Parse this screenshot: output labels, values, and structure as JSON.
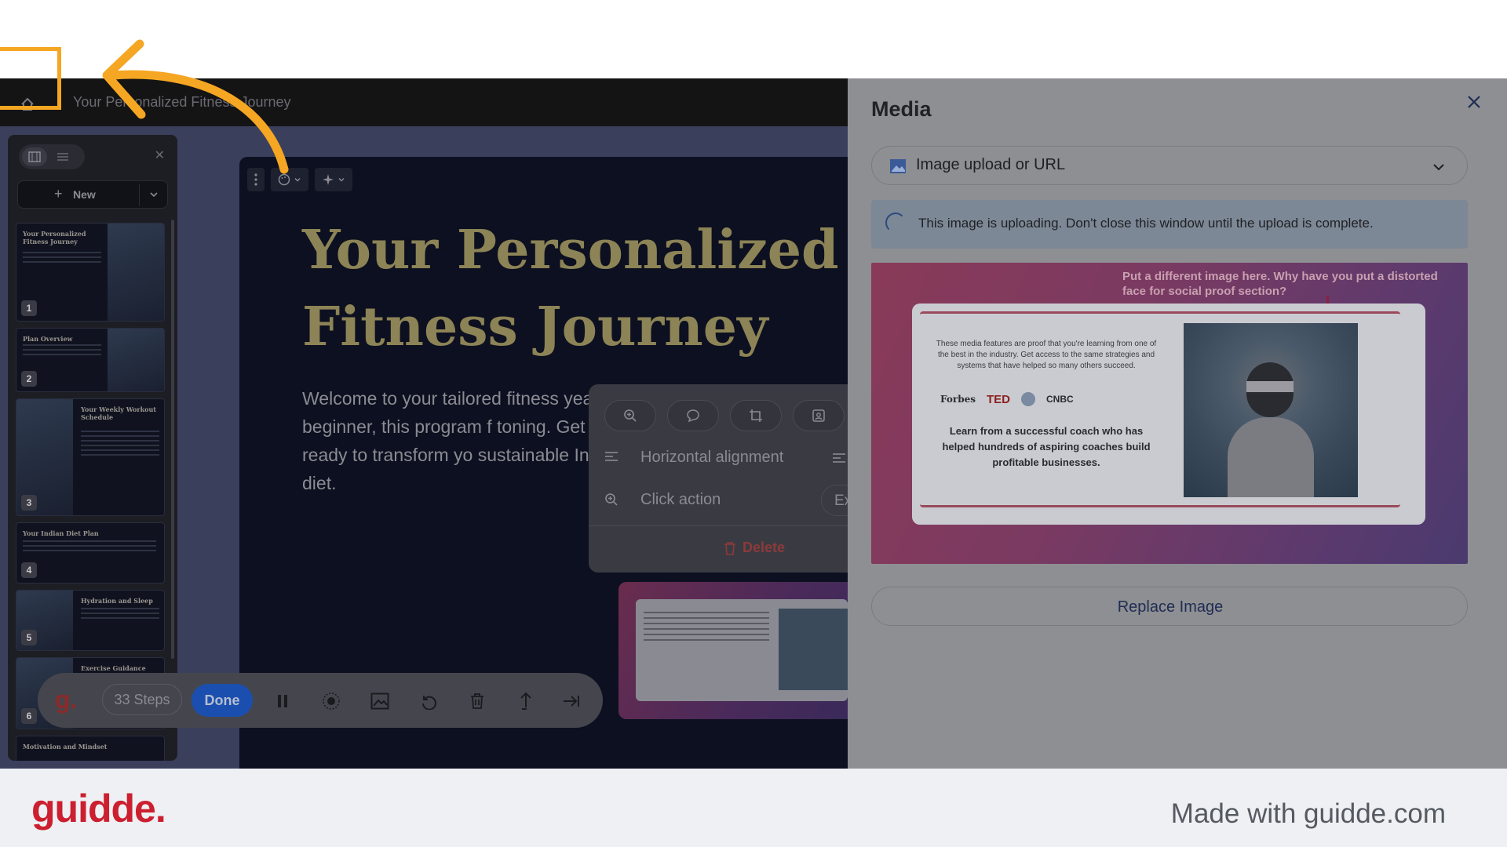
{
  "app": {
    "document_title": "Your Personalized Fitness Journey"
  },
  "sidebar": {
    "new_label": "New",
    "thumbnails": [
      {
        "num": "1",
        "title": "Your Personalized Fitness Journey"
      },
      {
        "num": "2",
        "title": "Plan Overview"
      },
      {
        "num": "3",
        "title": "Your Weekly Workout Schedule"
      },
      {
        "num": "4",
        "title": "Your Indian Diet Plan"
      },
      {
        "num": "5",
        "title": "Hydration and Sleep"
      },
      {
        "num": "6",
        "title": "Exercise Guidance"
      },
      {
        "num": "",
        "title": "Motivation and Mindset"
      }
    ]
  },
  "slide": {
    "heading_line1": "Your Personalized",
    "heading_line2": "Fitness Journey",
    "body": "Welcome to your tailored fitness year-old beginner, this program f toning. Get ready to transform yo sustainable Indian diet."
  },
  "popover": {
    "horizontal_alignment": "Horizontal alignment",
    "click_action": "Click action",
    "expand": "Expa",
    "delete": "Delete"
  },
  "recorder": {
    "logo": "g.",
    "steps": "33 Steps",
    "done": "Done"
  },
  "media_panel": {
    "title": "Media",
    "source_select": "Image upload or URL",
    "upload_notice": "This image is uploading. Don't close this window until the upload is complete.",
    "replace_button": "Replace Image",
    "image": {
      "caption": "Put a different image here. Why have you put a distorted face for social proof section?",
      "card_text": "These media features are proof that you're learning from one of the best in the industry. Get access to the same strategies and systems that have helped so many others succeed.",
      "card_bold": "Learn from a successful coach who has helped hundreds of aspiring coaches build profitable businesses.",
      "logos": [
        "Forbes",
        "TED",
        "CNBC"
      ]
    }
  },
  "footer": {
    "logo": "guidde.",
    "made_with": "Made with guidde.com"
  },
  "colors": {
    "highlight": "#f5a623",
    "brand_red": "#cc1f2f",
    "done_blue": "#1a4fb0"
  }
}
